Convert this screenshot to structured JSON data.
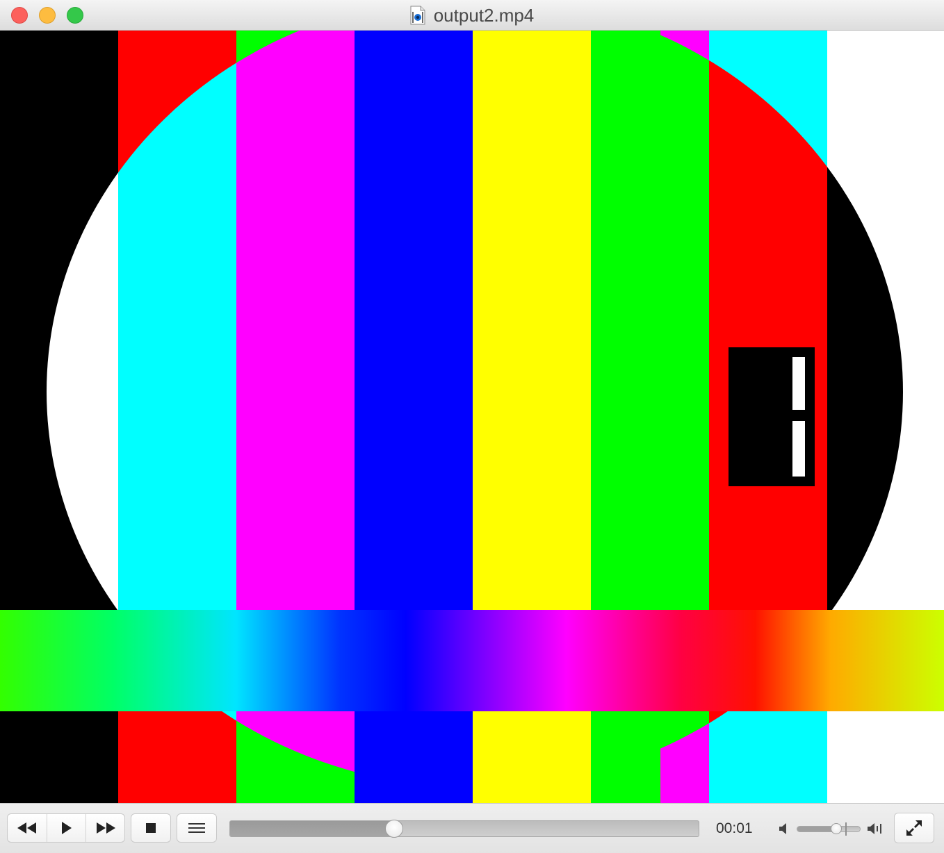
{
  "window": {
    "title": "output2.mp4",
    "file_icon": "movie-file-icon"
  },
  "video": {
    "content": "color-bar-test-pattern",
    "bar_colors": [
      "#000000",
      "#ff0000",
      "#00ffff",
      "#ff00ff",
      "#0000ff",
      "#ffff00",
      "#00ff00",
      "#ff0000",
      "#00ffff",
      "#ffffff"
    ]
  },
  "controls": {
    "rewind_icon": "rewind-icon",
    "play_icon": "play-icon",
    "fast_forward_icon": "fast-forward-icon",
    "stop_icon": "stop-icon",
    "playlist_icon": "playlist-icon",
    "elapsed_time": "00:01",
    "progress_fraction": 0.35,
    "volume_fraction": 0.62,
    "volume_low_icon": "volume-low-icon",
    "volume_high_icon": "volume-high-icon",
    "fullscreen_icon": "fullscreen-icon"
  }
}
